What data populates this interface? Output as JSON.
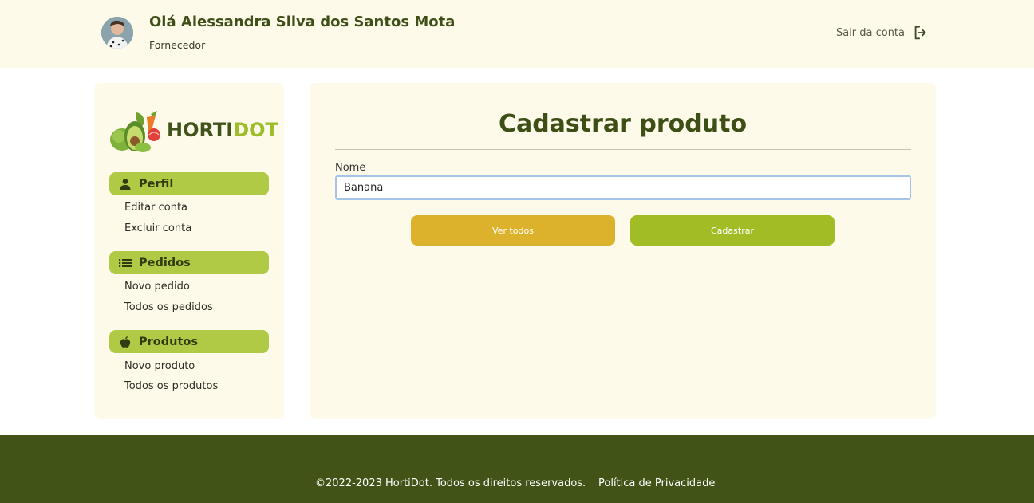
{
  "header": {
    "greeting": "Olá Alessandra Silva dos Santos Mota",
    "role": "Fornecedor",
    "logout_label": "Sair da conta"
  },
  "sidebar": {
    "logo_prefix": "HORTI",
    "logo_suffix": "DOT",
    "sections": [
      {
        "label": "Perfil",
        "icon": "person-icon",
        "links": [
          "Editar conta",
          "Excluir conta"
        ]
      },
      {
        "label": "Pedidos",
        "icon": "list-icon",
        "links": [
          "Novo pedido",
          "Todos os pedidos"
        ]
      },
      {
        "label": "Produtos",
        "icon": "apple-icon",
        "links": [
          "Novo produto",
          "Todos os produtos"
        ]
      }
    ]
  },
  "main": {
    "title": "Cadastrar produto",
    "name_label": "Nome",
    "name_value": "Banana",
    "view_all_label": "Ver todos",
    "submit_label": "Cadastrar"
  },
  "footer": {
    "copyright": "©2022-2023 HortiDot. Todos os direitos reservados.",
    "privacy": "Política de Privacidade"
  },
  "colors": {
    "header_bg": "#fefaea",
    "pill": "#b1ca46",
    "button_view_all": "#dcb22c",
    "button_submit": "#a2bc26",
    "footer_bg": "#425317",
    "title": "#3d4f14"
  }
}
